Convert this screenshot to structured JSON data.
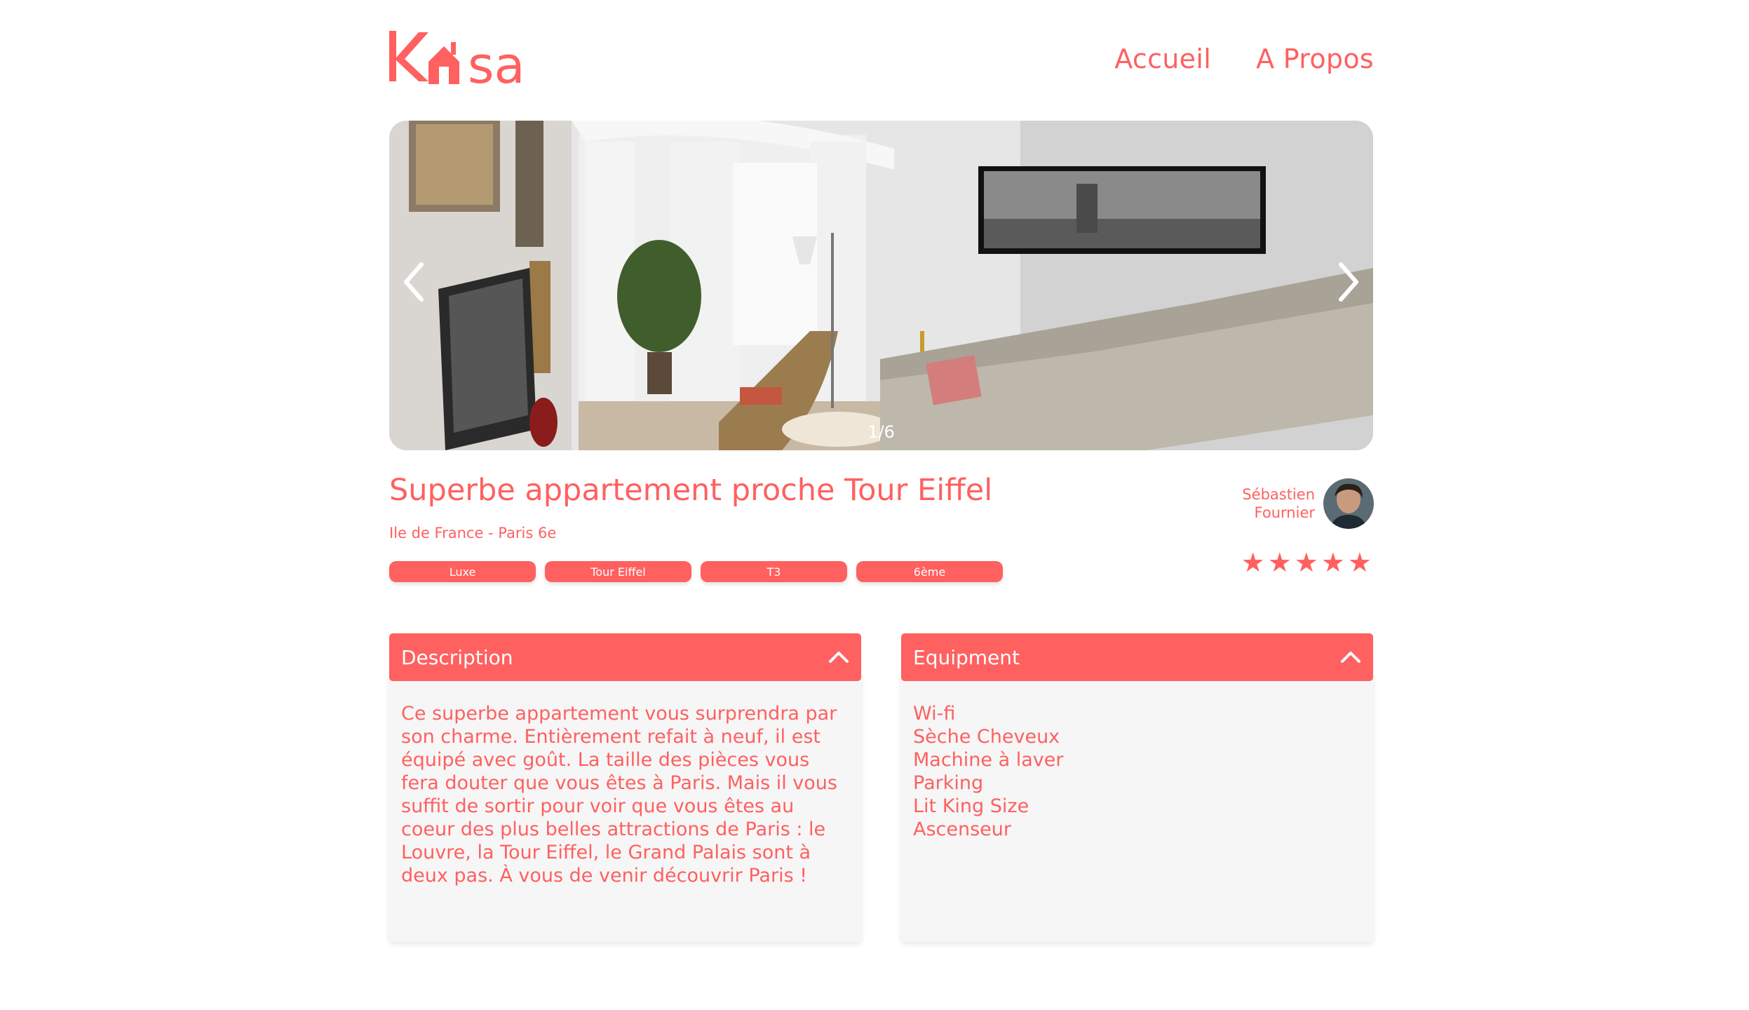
{
  "header": {
    "logo_text": "Kasa",
    "nav": [
      {
        "label": "Accueil"
      },
      {
        "label": "A Propos"
      }
    ]
  },
  "carousel": {
    "counter": "1/6"
  },
  "listing": {
    "title": "Superbe appartement proche Tour Eiffel",
    "location": "Ile de France - Paris 6e",
    "tags": [
      "Luxe",
      "Tour Eiffel",
      "T3",
      "6ème"
    ],
    "host": {
      "first_name": "Sébastien",
      "last_name": "Fournier"
    },
    "rating": 5,
    "rating_max": 5
  },
  "description": {
    "title": "Description",
    "text": "Ce superbe appartement vous surprendra par son charme. Entièrement refait à neuf, il est équipé avec goût. La taille des pièces vous fera douter que vous êtes à Paris. Mais il vous suffit de sortir pour voir que vous êtes au coeur des plus belles attractions de Paris : le Louvre, la Tour Eiffel, le Grand Palais sont à deux pas. À vous de venir découvrir Paris !"
  },
  "equipment": {
    "title": "Equipment",
    "items": [
      "Wi-fi",
      "Sèche Cheveux",
      "Machine à laver",
      "Parking",
      "Lit King Size",
      "Ascenseur"
    ]
  },
  "colors": {
    "accent": "#FF6060",
    "panel_bg": "#F6F6F6"
  }
}
